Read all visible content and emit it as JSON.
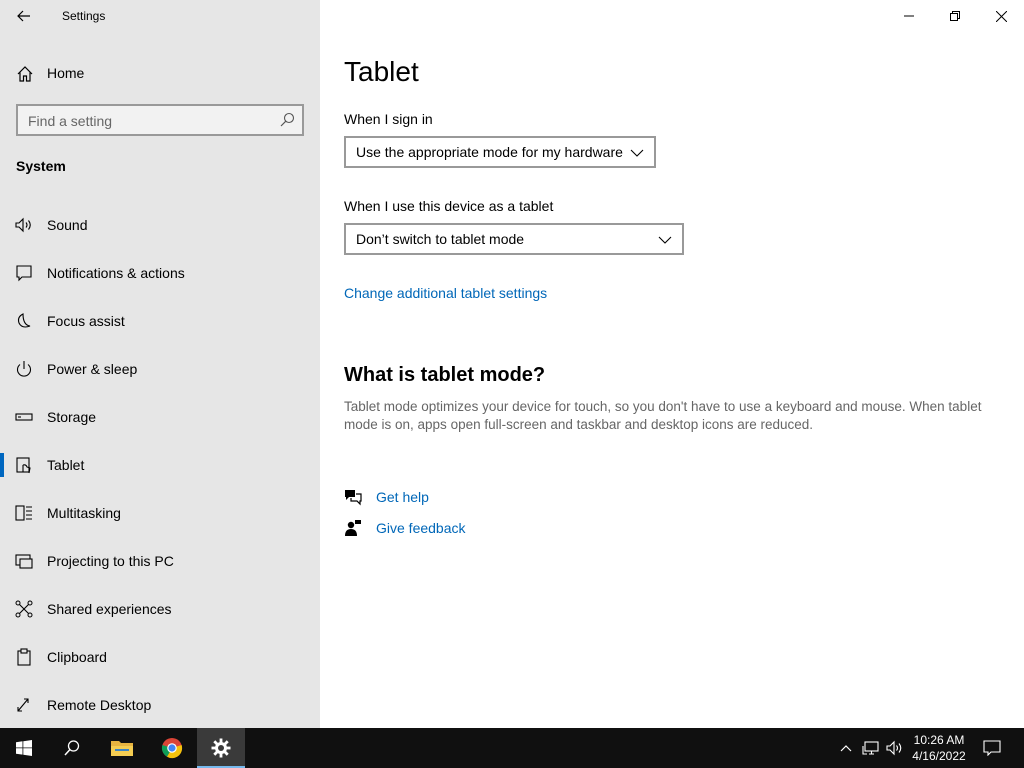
{
  "window": {
    "title": "Settings"
  },
  "sidebar": {
    "home_label": "Home",
    "search_placeholder": "Find a setting",
    "section_title": "System",
    "items": [
      {
        "label": "Sound",
        "icon": "speaker-icon"
      },
      {
        "label": "Notifications & actions",
        "icon": "notification-icon"
      },
      {
        "label": "Focus assist",
        "icon": "moon-icon"
      },
      {
        "label": "Power & sleep",
        "icon": "power-icon"
      },
      {
        "label": "Storage",
        "icon": "storage-icon"
      },
      {
        "label": "Tablet",
        "icon": "tablet-icon",
        "selected": true
      },
      {
        "label": "Multitasking",
        "icon": "multitasking-icon"
      },
      {
        "label": "Projecting to this PC",
        "icon": "projecting-icon"
      },
      {
        "label": "Shared experiences",
        "icon": "shared-experiences-icon"
      },
      {
        "label": "Clipboard",
        "icon": "clipboard-icon"
      },
      {
        "label": "Remote Desktop",
        "icon": "remote-desktop-icon"
      }
    ]
  },
  "main": {
    "title": "Tablet",
    "sign_in_label": "When I sign in",
    "sign_in_value": "Use the appropriate mode for my hardware",
    "tablet_use_label": "When I use this device as a tablet",
    "tablet_use_value": "Don’t switch to tablet mode",
    "additional_link": "Change additional tablet settings",
    "what_is_title": "What is tablet mode?",
    "what_is_desc": "Tablet mode optimizes your device for touch, so you don't have to use a keyboard and mouse. When tablet mode is on, apps open full-screen and taskbar and desktop icons are reduced.",
    "get_help": "Get help",
    "give_feedback": "Give feedback"
  },
  "taskbar": {
    "time": "10:26 AM",
    "date": "4/16/2022"
  },
  "colors": {
    "accent": "#0067b8",
    "sidebar_bg": "#e6e6e6",
    "taskbar_bg": "#101010"
  }
}
